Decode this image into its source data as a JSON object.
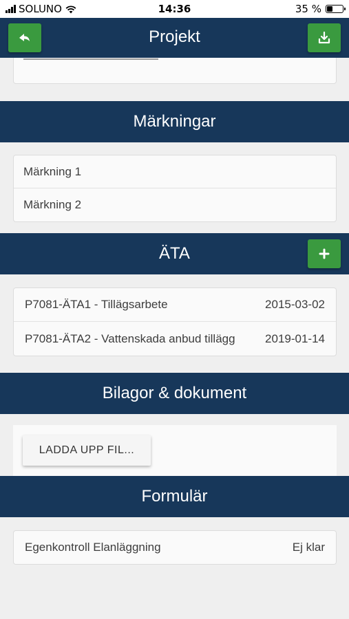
{
  "status_bar": {
    "carrier": "SOLUNO",
    "time": "14:36",
    "battery": "35 %",
    "battery_level": 0.35
  },
  "header": {
    "title": "Projekt"
  },
  "sections": {
    "markningar": {
      "title": "Märkningar",
      "items": [
        {
          "label": "Märkning 1"
        },
        {
          "label": "Märkning 2"
        }
      ]
    },
    "ata": {
      "title": "ÄTA",
      "items": [
        {
          "name": "P7081-ÄTA1 - Tillägsarbete",
          "date": "2015-03-02"
        },
        {
          "name": "P7081-ÄTA2 - Vattenskada anbud tillägg",
          "date": "2019-01-14"
        }
      ]
    },
    "bilagor": {
      "title": "Bilagor & dokument",
      "upload_label": "LADDA UPP FIL..."
    },
    "formular": {
      "title": "Formulär",
      "items": [
        {
          "name": "Egenkontroll Elanläggning",
          "status": "Ej klar"
        }
      ]
    }
  },
  "colors": {
    "header": "#17375a",
    "button": "#3a9a3f",
    "background": "#efefef"
  }
}
